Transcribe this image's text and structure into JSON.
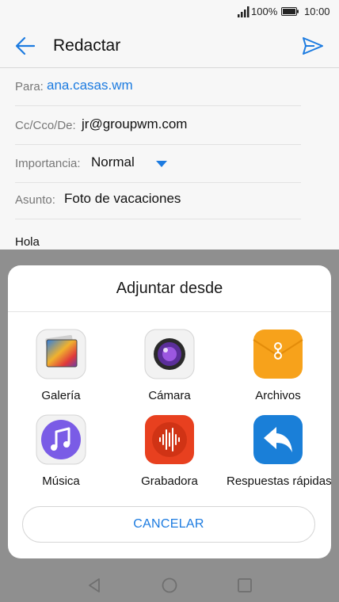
{
  "status_bar": {
    "battery_percent": "100%",
    "time": "10:00"
  },
  "header": {
    "title": "Redactar",
    "back_icon": "arrow-left-icon",
    "send_icon": "send-icon"
  },
  "form": {
    "to_label": "Para:",
    "to_value": "ana.casas.wm",
    "cc_label": "Cc/Cco/De:",
    "cc_value": "jr@groupwm.com",
    "priority_label": "Importancia:",
    "priority_value": "Normal",
    "subject_label": "Asunto:",
    "subject_value": "Foto de vacaciones",
    "body": "Hola"
  },
  "sheet": {
    "title": "Adjuntar desde",
    "options": [
      {
        "label": "Galería",
        "icon": "gallery-icon"
      },
      {
        "label": "Cámara",
        "icon": "camera-icon"
      },
      {
        "label": "Archivos",
        "icon": "files-icon"
      },
      {
        "label": "Música",
        "icon": "music-icon"
      },
      {
        "label": "Grabadora",
        "icon": "recorder-icon"
      },
      {
        "label": "Respuestas rápidas",
        "icon": "quick-reply-icon"
      }
    ],
    "cancel_label": "CANCELAR"
  },
  "colors": {
    "accent": "#1c7be0",
    "scrim": "#8f8f8f",
    "sheet": "#ffffff"
  }
}
